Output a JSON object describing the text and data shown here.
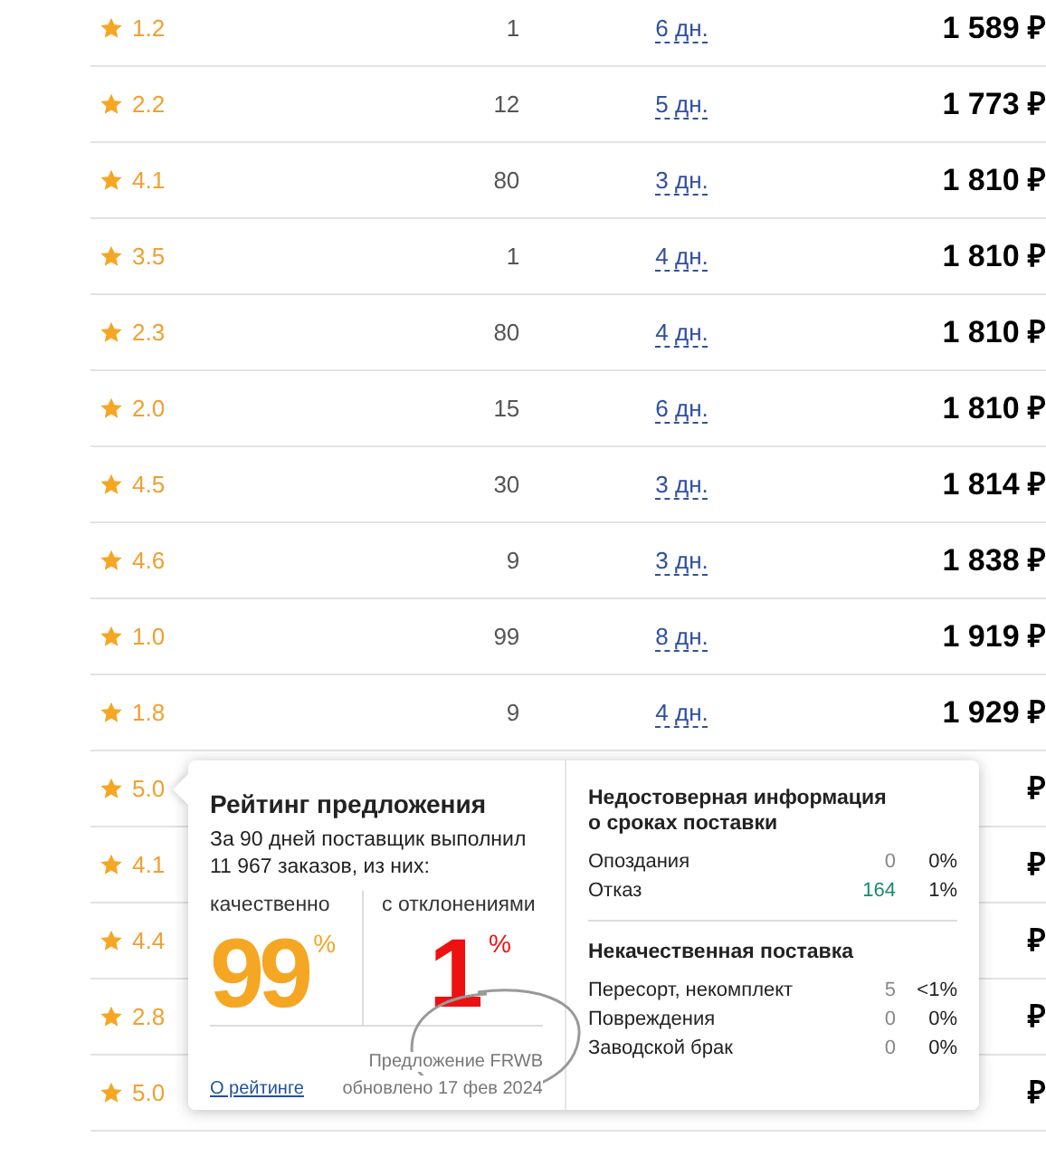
{
  "rows": [
    {
      "rating": "1.2",
      "count": "1",
      "days": "6 дн.",
      "price": "1 589 ₽"
    },
    {
      "rating": "2.2",
      "count": "12",
      "days": "5 дн.",
      "price": "1 773 ₽"
    },
    {
      "rating": "4.1",
      "count": "80",
      "days": "3 дн.",
      "price": "1 810 ₽"
    },
    {
      "rating": "3.5",
      "count": "1",
      "days": "4 дн.",
      "price": "1 810 ₽"
    },
    {
      "rating": "2.3",
      "count": "80",
      "days": "4 дн.",
      "price": "1 810 ₽"
    },
    {
      "rating": "2.0",
      "count": "15",
      "days": "6 дн.",
      "price": "1 810 ₽"
    },
    {
      "rating": "4.5",
      "count": "30",
      "days": "3 дн.",
      "price": "1 814 ₽"
    },
    {
      "rating": "4.6",
      "count": "9",
      "days": "3 дн.",
      "price": "1 838 ₽"
    },
    {
      "rating": "1.0",
      "count": "99",
      "days": "8 дн.",
      "price": "1 919 ₽"
    },
    {
      "rating": "1.8",
      "count": "9",
      "days": "4 дн.",
      "price": "1 929 ₽"
    },
    {
      "rating": "5.0",
      "price": "₽"
    },
    {
      "rating": "4.1",
      "price": "₽"
    },
    {
      "rating": "4.4",
      "price": "₽"
    },
    {
      "rating": "2.8",
      "price": "₽"
    },
    {
      "rating": "5.0",
      "price": "₽"
    }
  ],
  "popup": {
    "title": "Рейтинг предложения",
    "summary": "За 90 дней поставщик выполнил 11 967 заказов, из них:",
    "good": {
      "label": "качественно",
      "value": "99",
      "unit": "%"
    },
    "bad": {
      "label": "с отклонениями",
      "value": "1",
      "unit": "%"
    },
    "offer": "Предложение FRWB",
    "updated": "обновлено 17 фев 2024",
    "link": "О рейтинге",
    "sections": [
      {
        "title": "Недостоверная информация о сроках поставки",
        "items": [
          {
            "label": "Опоздания",
            "count": "0",
            "percent": "0%",
            "highlight": false
          },
          {
            "label": "Отказ",
            "count": "164",
            "percent": "1%",
            "highlight": true
          }
        ]
      },
      {
        "title": "Некачественная поставка",
        "items": [
          {
            "label": "Пересорт, некомплект",
            "count": "5",
            "percent": "<1%",
            "highlight": false
          },
          {
            "label": "Повреждения",
            "count": "0",
            "percent": "0%",
            "highlight": false
          },
          {
            "label": "Заводской брак",
            "count": "0",
            "percent": "0%",
            "highlight": false
          }
        ]
      }
    ]
  }
}
